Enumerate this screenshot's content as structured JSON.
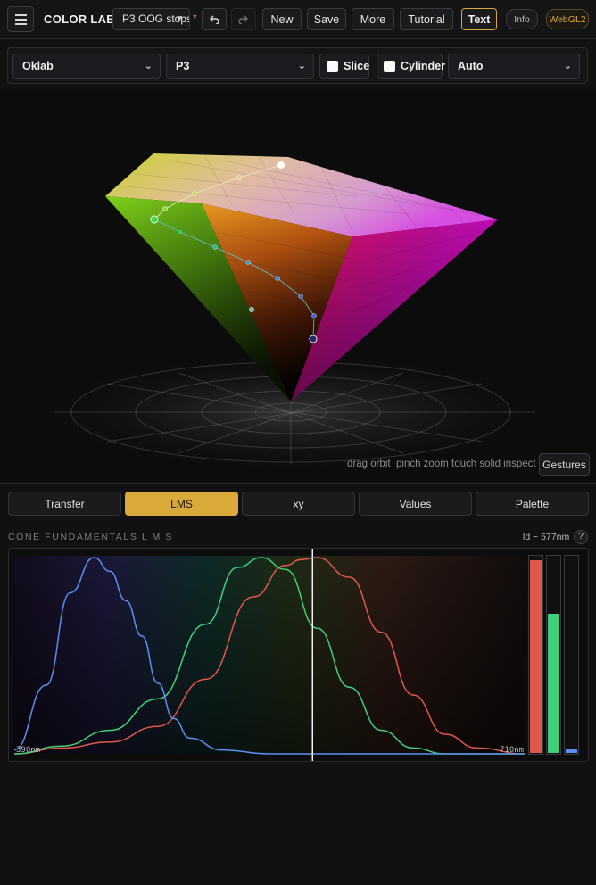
{
  "app": {
    "brand": "COLOR LAB",
    "preset": "P3 OOG stops",
    "dirty_marker": "*"
  },
  "toolbar": {
    "undo_icon": "undo-icon",
    "redo_icon": "redo-icon",
    "new_label": "New",
    "save_label": "Save",
    "more_label": "More",
    "tutorial_label": "Tutorial",
    "text_label": "Text",
    "info_label": "Info",
    "renderer_badge": "WebGL2"
  },
  "controls": {
    "space": "Oklab",
    "gamut": "P3",
    "slice_label": "Slice",
    "slice_checked": false,
    "cylinder_label": "Cylinder",
    "cylinder_checked": false,
    "mode": "Auto"
  },
  "viewport": {
    "hints": [
      "drag orbit",
      "pinch zoom",
      "touch solid inspect"
    ],
    "gestures_label": "Gestures"
  },
  "tabs": [
    {
      "label": "Transfer",
      "active": false
    },
    {
      "label": "LMS",
      "active": true
    },
    {
      "label": "xy",
      "active": false
    },
    {
      "label": "Values",
      "active": false
    },
    {
      "label": "Palette",
      "active": false
    }
  ],
  "lms_panel": {
    "title": "CONE FUNDAMENTALS L M S",
    "dominant_wavelength": "ld ~ 577nm",
    "help_label": "?",
    "axis_min_label": "390nm",
    "axis_max_label": "710nm"
  },
  "chart_data": {
    "type": "line",
    "xlim": [
      390,
      710
    ],
    "ylim": [
      0,
      1
    ],
    "cursor_x": 577,
    "series": [
      {
        "color": "#e0584a",
        "x": [
          390,
          420,
          450,
          480,
          510,
          540,
          560,
          570,
          580,
          600,
          620,
          640,
          660,
          680,
          710
        ],
        "y": [
          0.0,
          0.03,
          0.06,
          0.14,
          0.38,
          0.8,
          0.96,
          0.99,
          1.0,
          0.9,
          0.62,
          0.3,
          0.1,
          0.03,
          0.0
        ]
      },
      {
        "color": "#3fcf78",
        "x": [
          390,
          420,
          450,
          480,
          510,
          530,
          545,
          560,
          580,
          600,
          620,
          640,
          660,
          710
        ],
        "y": [
          0.0,
          0.04,
          0.12,
          0.28,
          0.66,
          0.95,
          1.0,
          0.94,
          0.64,
          0.34,
          0.12,
          0.03,
          0.0,
          0.0
        ]
      },
      {
        "color": "#5b8ff2",
        "x": [
          390,
          410,
          425,
          440,
          450,
          460,
          470,
          480,
          490,
          500,
          520,
          550,
          600,
          710
        ],
        "y": [
          0.02,
          0.35,
          0.82,
          1.0,
          0.93,
          0.78,
          0.6,
          0.36,
          0.18,
          0.08,
          0.02,
          0.0,
          0.0,
          0.0
        ]
      }
    ],
    "bars": [
      {
        "color": "#e0584a",
        "value": 0.98
      },
      {
        "color": "#3fcf78",
        "value": 0.71
      },
      {
        "color": "#5b8ff2",
        "value": 0.02
      }
    ]
  }
}
